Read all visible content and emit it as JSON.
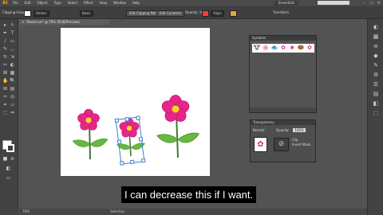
{
  "app": {
    "logo": "Ai"
  },
  "menu": [
    "File",
    "Edit",
    "Object",
    "Type",
    "Select",
    "Effect",
    "View",
    "Window",
    "Help"
  ],
  "workspace": "Essentials",
  "window_controls": [
    "–",
    "▭",
    "✕"
  ],
  "control_bar": {
    "selection_label": "Clipping Group",
    "stroke_label": "Stroke:",
    "brush_label": "Basic",
    "style_label": "Opacity: 100%",
    "edit_clipping_path": "Edit Clipping Path",
    "edit_contents": "Edit Contents",
    "align_label": "Transform",
    "align2_label": "Align:",
    "fill_color": "#ffffff",
    "stroke_color": "#ff3b3b",
    "stroke_color2": "#e8a14a"
  },
  "document_tab": {
    "close": "×",
    "title": "flowers.ai* @ 76% (RGB/Preview)"
  },
  "tools": [
    "▸",
    "↖",
    "✒",
    "T",
    "/",
    "▭",
    "✎",
    "◡",
    "↻",
    "⇲",
    "✂",
    "◐",
    "⌘",
    "▦",
    "✋",
    "🔍"
  ],
  "symbols_panel": {
    "title": "Symbols",
    "items": [
      "🐮",
      "🌸",
      "🐟",
      "✿",
      "❀",
      "🍩",
      "✿"
    ]
  },
  "transparency_panel": {
    "title": "Transparency",
    "blend_mode": "Normal",
    "opacity_label": "Opacity:",
    "opacity_value": "100%",
    "mask_button": "⊘",
    "option_clip": "Clip",
    "option_invert": "Invert Mask"
  },
  "dock_icons": [
    "◐",
    "▦",
    "≡",
    "◆",
    "✎",
    "⚙",
    "☰",
    "▤",
    "◧",
    "⬚"
  ],
  "status_bar": {
    "zoom": "76%",
    "tool": "Selection"
  },
  "subtitle": "I can decrease this if I want.",
  "colors": {
    "petal": "#e6268a",
    "petal_dark": "#c2186e",
    "center": "#f7d51c",
    "stem": "#3f7a2c",
    "leaf": "#66b93d",
    "selection": "#3e7fd1"
  }
}
